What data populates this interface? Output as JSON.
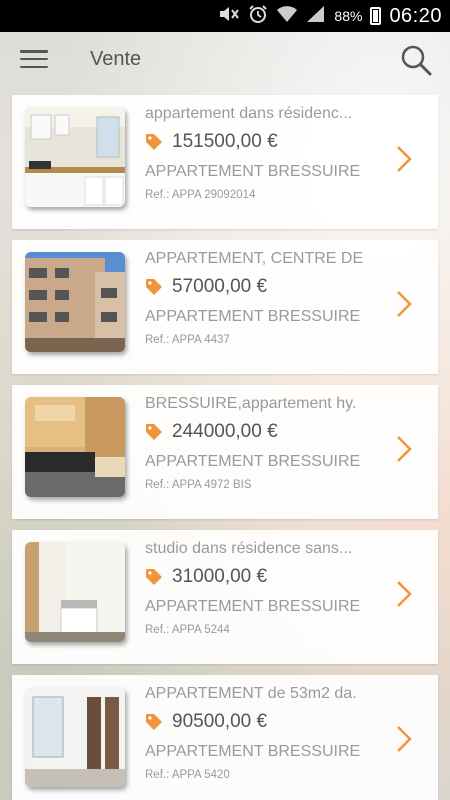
{
  "status_bar": {
    "battery_percent": "88%",
    "time": "06:20"
  },
  "app_bar": {
    "title": "Vente"
  },
  "colors": {
    "accent": "#f0953a",
    "title_text": "#9a9a9a",
    "price_text": "#555555"
  },
  "listings": [
    {
      "title": "appartement dans résidenc...",
      "price": "151500,00 €",
      "category": "APPARTEMENT BRESSUIRE",
      "ref": "Ref.: APPA 29092014",
      "thumb": "kitchen-photo"
    },
    {
      "title": "APPARTEMENT, CENTRE DE",
      "price": "57000,00 €",
      "category": "APPARTEMENT BRESSUIRE",
      "ref": "Ref.: APPA 4437",
      "thumb": "building-photo"
    },
    {
      "title": "BRESSUIRE,appartement hy.",
      "price": "244000,00 €",
      "category": "APPARTEMENT BRESSUIRE",
      "ref": "Ref.: APPA 4972 BIS",
      "thumb": "modern-kitchen-photo"
    },
    {
      "title": "studio dans résidence sans...",
      "price": "31000,00 €",
      "category": "APPARTEMENT BRESSUIRE",
      "ref": "Ref.: APPA 5244",
      "thumb": "studio-photo"
    },
    {
      "title": "APPARTEMENT de 53m2 da.",
      "price": "90500,00 €",
      "category": "APPARTEMENT BRESSUIRE",
      "ref": "Ref.: APPA 5420",
      "thumb": "room-photo"
    }
  ]
}
